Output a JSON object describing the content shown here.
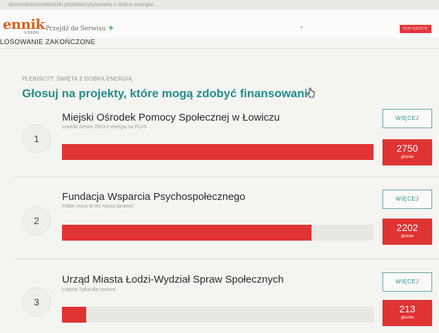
{
  "browser": {
    "url": "dziennikdzienniklodzki.pl/plebiscyty/swieta-z-dobra-energia/..."
  },
  "header": {
    "logo_text": "ennik",
    "logo_subtext": "ŁÓDZKI",
    "nav_link": "Przejdź do Serwisu",
    "nav_plus": "+",
    "buy_button": "KUP GAZETĘ"
  },
  "status": "LOSOWANIE ZAKOŃCZONE",
  "breadcrumb": "PLEBISCYT: ŚWIĘTA Z DOBRĄ ENERGIĄ",
  "page_title": "Głosuj na projekty, które mogą zdobyć finansowanie",
  "colors": {
    "accent_teal": "#1f8f8c",
    "vote_red": "#e03333",
    "logo_orange": "#d8601f"
  },
  "entries": [
    {
      "rank": "1",
      "name": "Miejski Ośrodek Pomocy Społecznej w Łowiczu",
      "subtitle": "Łowicki Senior 2023 z energią na PLUS",
      "progress": 1.0,
      "more_label": "WIĘCEJ",
      "votes": "2750",
      "votes_unit": "głosów"
    },
    {
      "rank": "2",
      "name": "Fundacja Wsparcia Psychospołecznego",
      "subtitle": "Pobór mocy to też nasza sprawa!",
      "progress": 0.8,
      "more_label": "WIĘCEJ",
      "votes": "2202",
      "votes_unit": "głosów"
    },
    {
      "rank": "3",
      "name": "Urząd Miasta Łodzi-Wydział Spraw Społecznych",
      "subtitle": "Łódzka Tytka dla seniora",
      "progress": 0.077,
      "more_label": "WIĘCEJ",
      "votes": "213",
      "votes_unit": "głosów"
    }
  ]
}
